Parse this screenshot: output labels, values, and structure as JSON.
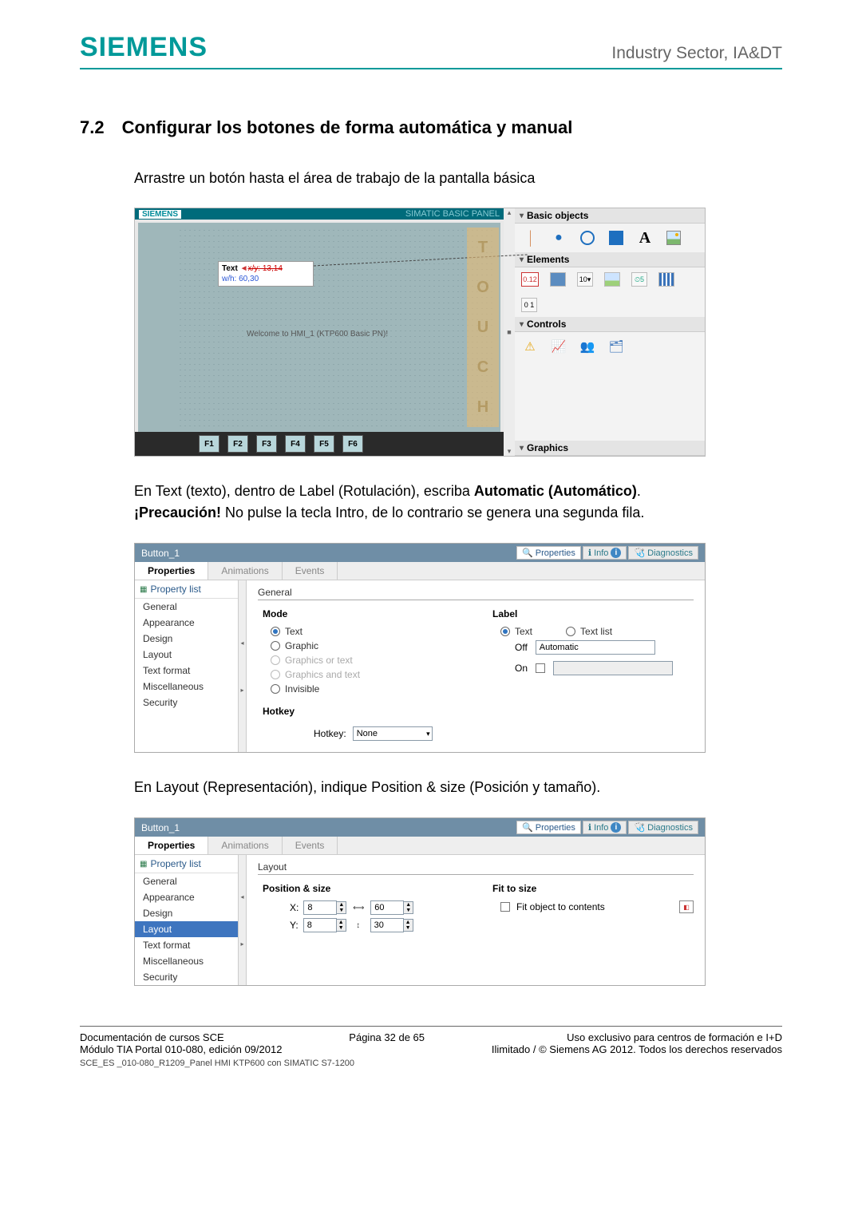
{
  "header": {
    "logo": "SIEMENS",
    "right": "Industry Sector, IA&DT"
  },
  "section": {
    "num": "7.2",
    "title": "Configurar los botones de forma automática y manual"
  },
  "intro": "Arrastre un botón hasta el área de trabajo de la pantalla básica",
  "shot1": {
    "brand": "SIEMENS",
    "panel_title": "SIMATIC BASIC PANEL",
    "text_label": "Text",
    "xy_label": "x/y:  13,14",
    "wh_label": "w/h:  60,30",
    "welcome": "Welcome to HMI_1 (KTP600 Basic PN)!",
    "touch": [
      "T",
      "O",
      "U",
      "C",
      "H"
    ],
    "fkeys": [
      "F1",
      "F2",
      "F3",
      "F4",
      "F5",
      "F6"
    ],
    "basic_objects": "Basic objects",
    "elements": "Elements",
    "controls": "Controls",
    "graphics": "Graphics"
  },
  "para2_a": "En Text (texto), dentro de Label (Rotulación), escriba ",
  "para2_b": "Automatic (Automático)",
  "para2_period": ".",
  "caution_label": "¡Precaución!",
  "caution_text": " No pulse la tecla Intro, de lo contrario se genera una segunda fila.",
  "shot2": {
    "object": "Button_1",
    "props_btn": "Properties",
    "info_btn": "Info",
    "diag_btn": "Diagnostics",
    "tab_props": "Properties",
    "tab_anim": "Animations",
    "tab_events": "Events",
    "prop_list": "Property list",
    "plist_items": [
      "General",
      "Appearance",
      "Design",
      "Layout",
      "Text format",
      "Miscellaneous",
      "Security"
    ],
    "general": "General",
    "mode": "Mode",
    "mode_text": "Text",
    "mode_graphic": "Graphic",
    "mode_gotext": "Graphics or text",
    "mode_gatext": "Graphics and text",
    "mode_invis": "Invisible",
    "label": "Label",
    "label_text": "Text",
    "label_textlist": "Text list",
    "off": "Off",
    "off_value": "Automatic",
    "on": "On",
    "hotkey": "Hotkey",
    "hotkey_label": "Hotkey:",
    "hotkey_value": "None"
  },
  "para3": "En Layout (Representación), indique Position & size (Posición y tamaño).",
  "shot3": {
    "object": "Button_1",
    "layout": "Layout",
    "pos_size": "Position & size",
    "x_label": "X:",
    "y_label": "Y:",
    "x_val": "8",
    "y_val": "8",
    "w_val": "60",
    "h_val": "30",
    "fit_title": "Fit to size",
    "fit_label": "Fit object to contents"
  },
  "footer": {
    "left1": "Documentación de cursos SCE",
    "left2": "Módulo TIA Portal 010-080, edición 09/2012",
    "mid": "Página 32 de 65",
    "right1": "Uso exclusivo para centros de formación e I+D",
    "right2": "Ilimitado / © Siemens AG 2012. Todos los derechos reservados",
    "code": "SCE_ES _010-080_R1209_Panel HMI KTP600 con SIMATIC S7-1200"
  }
}
